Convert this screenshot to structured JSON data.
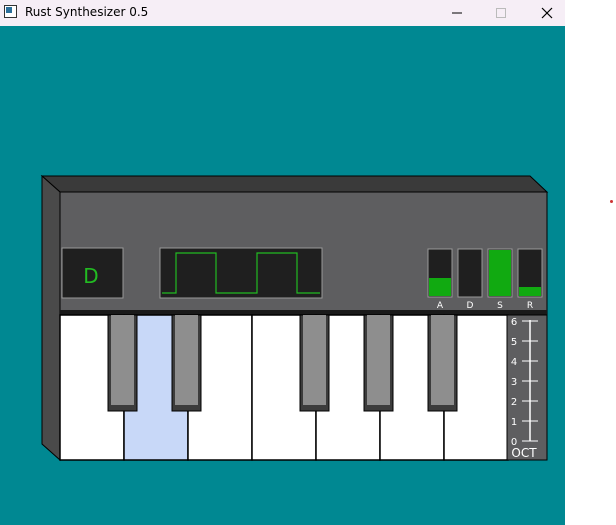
{
  "window": {
    "title": "Rust Synthesizer 0.5",
    "minimize_icon": "minimize-icon",
    "maximize_icon": "maximize-icon",
    "close_icon": "close-icon"
  },
  "synth": {
    "note_display": "D",
    "waveform": "square",
    "adsr": {
      "labels": [
        "A",
        "D",
        "S",
        "R"
      ],
      "levels": [
        0.4,
        0.0,
        1.0,
        0.2
      ]
    },
    "octave": {
      "label": "OCT",
      "ticks": [
        "6",
        "5",
        "4",
        "3",
        "2",
        "1",
        "0"
      ],
      "value": 6
    },
    "keys": {
      "white_count": 7,
      "pressed_white_index": 1
    }
  },
  "colors": {
    "background": "#008892",
    "lcd_green": "#22bb22",
    "pressed_key": "#c8d8f8"
  }
}
